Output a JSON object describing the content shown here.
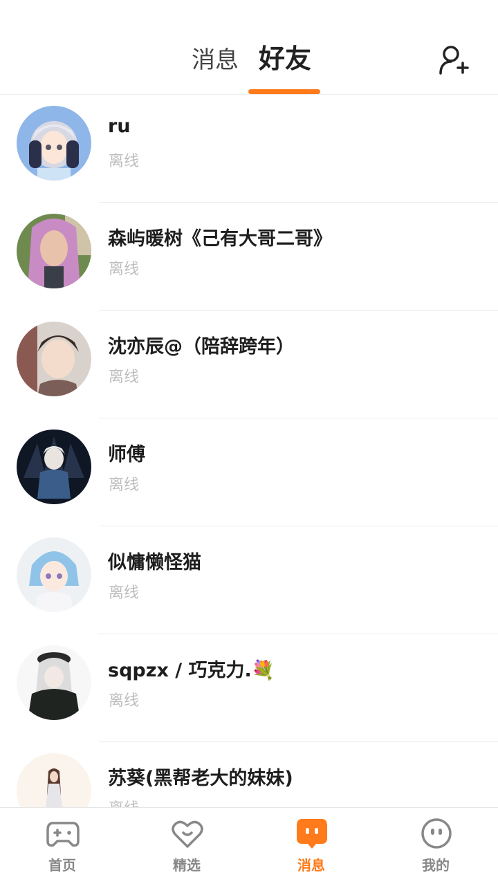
{
  "header": {
    "tabs": [
      {
        "label": "消息",
        "active": false
      },
      {
        "label": "好友",
        "active": true
      }
    ],
    "add_friend_icon": "add-user-icon",
    "accent_color": "#ff7a1a"
  },
  "friends": [
    {
      "name": "ru",
      "status": "离线"
    },
    {
      "name": "森屿暖树《己有大哥二哥》",
      "status": "离线"
    },
    {
      "name": "沈亦辰@（陪辞跨年）",
      "status": "离线"
    },
    {
      "name": "师傅",
      "status": "离线"
    },
    {
      "name": "似慵懒怪猫",
      "status": "离线"
    },
    {
      "name": "sqpzx / 巧克力.💐",
      "status": "离线"
    },
    {
      "name": "苏葵(黑帮老大的妹妹)",
      "status": "离线"
    }
  ],
  "bottom_nav": [
    {
      "label": "首页",
      "icon": "gamepad-icon",
      "active": false
    },
    {
      "label": "精选",
      "icon": "heart-icon",
      "active": false
    },
    {
      "label": "消息",
      "icon": "chat-bubble-icon",
      "active": true
    },
    {
      "label": "我的",
      "icon": "smiley-icon",
      "active": false
    }
  ]
}
